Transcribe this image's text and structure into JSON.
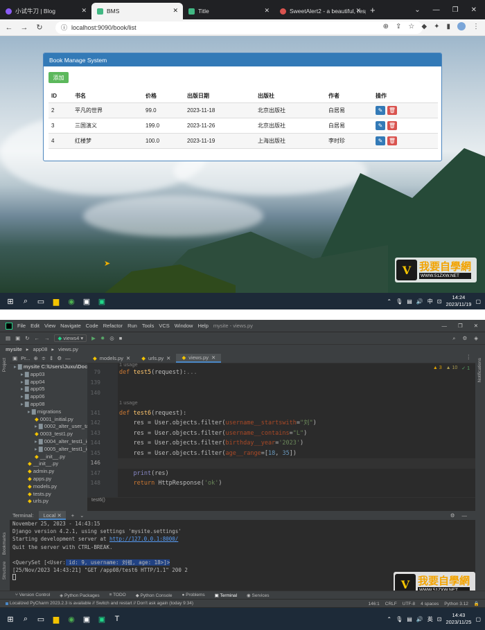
{
  "browser": {
    "tabs": [
      {
        "title": "小试牛刀 | Blog",
        "icon": "circle-icon",
        "color": "#8b5cf6"
      },
      {
        "title": "BMS",
        "icon": "vue-icon",
        "color": "#41b883"
      },
      {
        "title": "Title",
        "icon": "vue-icon",
        "color": "#41b883"
      },
      {
        "title": "SweetAlert2 - a beautiful, resp",
        "icon": "globe-icon",
        "color": "#d9534f"
      }
    ],
    "new_tab": "+",
    "window_controls": [
      "⌄",
      "—",
      "❐",
      "✕"
    ],
    "url": "localhost:9090/book/list"
  },
  "bms": {
    "panel_title": "Book Manage System",
    "add_button": "添加",
    "columns": [
      "ID",
      "书名",
      "价格",
      "出版日期",
      "出版社",
      "作者",
      "操作"
    ],
    "rows": [
      {
        "id": "2",
        "name": "平凡的世界",
        "price": "99.0",
        "date": "2023-11-18",
        "publisher": "北京出版社",
        "author": "白居易"
      },
      {
        "id": "3",
        "name": "三国演义",
        "price": "199.0",
        "date": "2023-11-26",
        "publisher": "北京出版社",
        "author": "白居易"
      },
      {
        "id": "4",
        "name": "红楼梦",
        "price": "100.0",
        "date": "2023-11-19",
        "publisher": "上海出版社",
        "author": "李时珍"
      }
    ]
  },
  "watermark": {
    "title": "我要自學網",
    "url": "WWW.51ZXW.NET"
  },
  "taskbar_top": {
    "time": "14:24",
    "date": "2023/11/19",
    "lang": "中"
  },
  "ide": {
    "menu": [
      "File",
      "Edit",
      "View",
      "Navigate",
      "Code",
      "Refactor",
      "Run",
      "Tools",
      "VCS",
      "Window",
      "Help",
      "mysite - views.py"
    ],
    "run_config": "views4",
    "breadcrumbs": [
      "mysite",
      "app08",
      "views.py"
    ],
    "project_label": "Pr...",
    "tree": [
      {
        "t": "mysite  C:\\Users\\Juxu\\Doc",
        "d": 0
      },
      {
        "t": "app03",
        "d": 1
      },
      {
        "t": "app04",
        "d": 1
      },
      {
        "t": "app05",
        "d": 1
      },
      {
        "t": "app06",
        "d": 1
      },
      {
        "t": "app08",
        "d": 1
      },
      {
        "t": "migrations",
        "d": 2
      },
      {
        "t": "0001_initial.py",
        "d": 3
      },
      {
        "t": "0002_alter_user_ta",
        "d": 3
      },
      {
        "t": "0003_test1.py",
        "d": 3
      },
      {
        "t": "0004_alter_test1_ic",
        "d": 3
      },
      {
        "t": "0005_alter_test1_ic",
        "d": 3
      },
      {
        "t": "__init__.py",
        "d": 3
      },
      {
        "t": "__init__.py",
        "d": 2
      },
      {
        "t": "admin.py",
        "d": 2
      },
      {
        "t": "apps.py",
        "d": 2
      },
      {
        "t": "models.py",
        "d": 2
      },
      {
        "t": "tests.py",
        "d": 2
      },
      {
        "t": "urls.py",
        "d": 2
      }
    ],
    "tabs": [
      "models.py",
      "urls.py",
      "views.py"
    ],
    "inspections": {
      "warnings": "▲ 3",
      "weak": "▲ 10",
      "ok": "✓ 1"
    },
    "usage_1": "1 usage",
    "usage_2": "1 usage",
    "line_numbers": [
      "79",
      "139",
      "140",
      "141",
      "142",
      "143",
      "144",
      "145",
      "146",
      "147",
      "148"
    ],
    "code_breadcrumb": "test6()",
    "terminal": {
      "label": "Terminal:",
      "tab": "Local",
      "lines": [
        "November 25, 2023 - 14:43:15",
        "Django version 4.2.1, using settings 'mysite.settings'",
        "Quit the server with CTRL-BREAK.",
        "",
        "[25/Nov/2023 14:43:21] \"GET /app08/test6 HTTP/1.1\" 200 2"
      ],
      "server_prefix": "Starting development server at ",
      "server_url": "http://127.0.0.1:8000/",
      "queryset_prefix": "<QuerySet [<User:",
      "queryset_sel": " id: 9, username: 刘祖, age: 18>",
      "queryset_suffix": "]>"
    },
    "toolwindows": [
      "Version Control",
      "Python Packages",
      "TODO",
      "Python Console",
      "Problems",
      "Terminal",
      "Services"
    ],
    "status_msg": "Localized PyCharm 2023.2.3 is available // Switch and restart // Don't ask again (today 9:34)",
    "status_right": [
      "146:1",
      "CRLF",
      "UTF-8",
      "4 spaces",
      "Python 3.12"
    ]
  },
  "taskbar_bottom": {
    "time": "14:43",
    "date": "2023/11/25",
    "lang": "英"
  }
}
